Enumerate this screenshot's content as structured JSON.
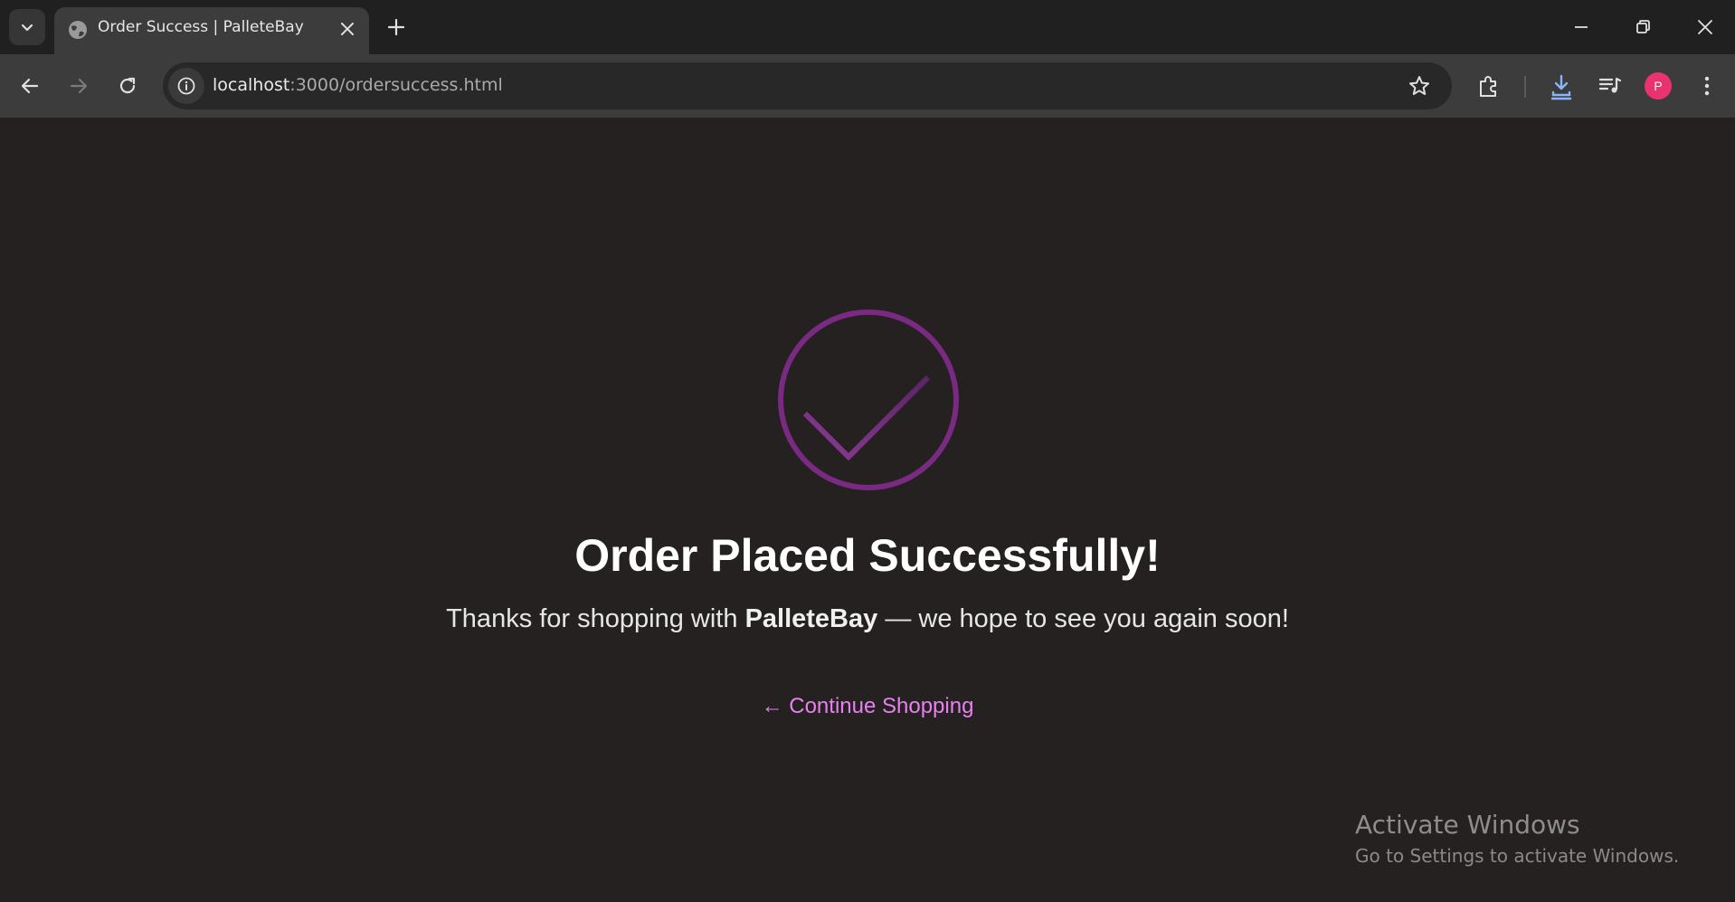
{
  "browser": {
    "tab": {
      "title": "Order Success | PalleteBay",
      "favicon": "globe-icon"
    },
    "url": {
      "host": "localhost",
      "path": ":3000/ordersuccess.html"
    },
    "profile_initial": "P"
  },
  "page": {
    "icon": "checkmark-circle-icon",
    "heading": "Order Placed Successfully!",
    "message_before": "Thanks for shopping with ",
    "brand": "PalleteBay",
    "message_after": " — we hope to see you again soon!",
    "continue_link": "← Continue Shopping"
  },
  "watermark": {
    "title": "Activate Windows",
    "subtitle": "Go to Settings to activate Windows."
  },
  "colors": {
    "page_background": "#242120",
    "accent_purple": "#7a2a82",
    "link": "#e880f0",
    "avatar": "#e8336f"
  }
}
